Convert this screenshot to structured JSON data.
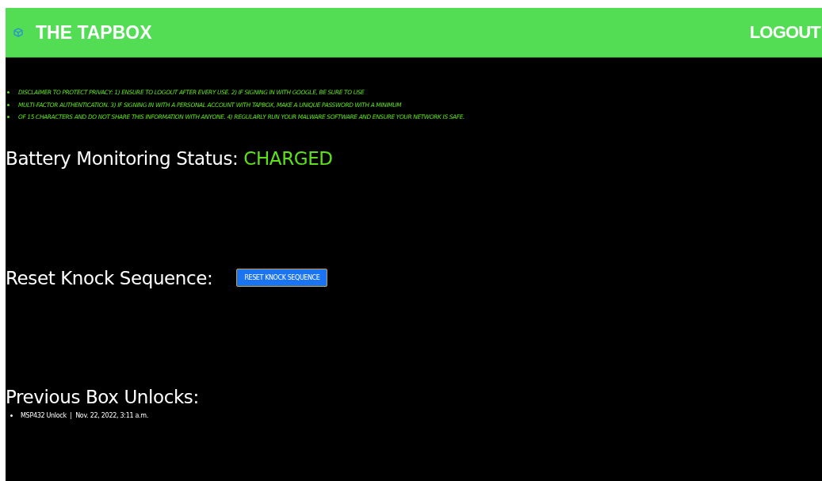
{
  "header": {
    "title": "THE TAPBOX",
    "logout": "LOGOUT"
  },
  "disclaimer": [
    "DISCLAIMER TO PROTECT PRIVACY: 1) ENSURE TO LOGOUT AFTER EVERY USE. 2) IF SIGNING IN WITH GOOGLE, BE SURE TO USE",
    "MULTI-FACTOR AUTHENTICATION. 3) IF SIGNING IN WITH A PERSONAL ACCOUNT WITH TAPBOX, MAKE A UNIQUE PASSWORD WITH A MINIMUM",
    "OF 15 CHARACTERS AND DO NOT SHARE THIS INFORMATION WITH ANYONE. 4) REGULARLY RUN YOUR MALWARE SOFTWARE AND ENSURE YOUR NETWORK IS SAFE."
  ],
  "battery": {
    "label": "Battery Monitoring Status:",
    "status": "CHARGED"
  },
  "reset": {
    "label": "Reset Knock Sequence:",
    "button": "RESET KNOCK SEQUENCE"
  },
  "unlocks": {
    "heading": "Previous Box Unlocks:",
    "items": [
      "MSP432 Unlock  |  Nov. 22, 2022, 3:11 a.m."
    ]
  }
}
